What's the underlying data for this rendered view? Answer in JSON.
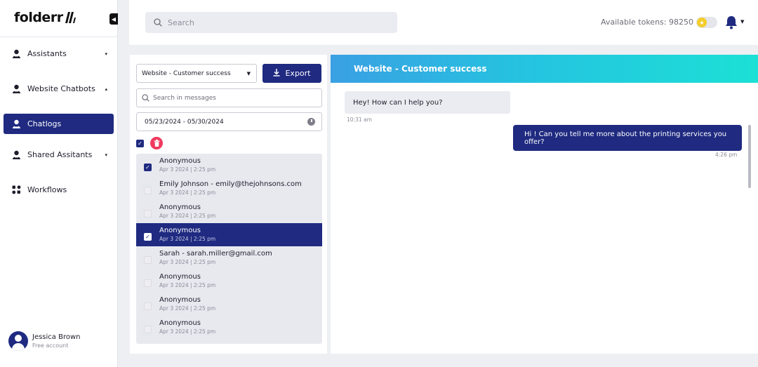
{
  "app": {
    "logo": "folderr"
  },
  "sidebar": {
    "items": [
      {
        "label": "Assistants",
        "icon": "assistant-icon",
        "caret": "▾",
        "active": false
      },
      {
        "label": "Website Chatbots",
        "icon": "assistant-icon",
        "caret": "▴",
        "active": false
      },
      {
        "label": "Chatlogs",
        "icon": "assistant-icon",
        "caret": "",
        "active": true
      },
      {
        "label": "Shared Assitants",
        "icon": "assistant-icon",
        "caret": "▾",
        "active": false
      },
      {
        "label": "Workflows",
        "icon": "workflow-icon",
        "caret": "",
        "active": false
      }
    ],
    "user": {
      "name": "Jessica Brown",
      "plan": "Free account"
    }
  },
  "header": {
    "search_placeholder": "Search",
    "tokens_label": "Available tokens: 98250",
    "help": "?"
  },
  "chatlogs": {
    "bot_select": "Website - Customer success",
    "export_label": "Export",
    "message_search_placeholder": "Search in messages",
    "date_range": "05/23/2024 - 05/30/2024",
    "conversations": [
      {
        "name": "Anonymous",
        "time": "Apr 3 2024 | 2:25 pm",
        "checked": true,
        "selected": false
      },
      {
        "name": "Emily Johnson  - emily@thejohnsons.com",
        "time": "Apr 3 2024 | 2:25 pm",
        "checked": false,
        "selected": false
      },
      {
        "name": "Anonymous",
        "time": "Apr 3 2024 | 2:25 pm",
        "checked": false,
        "selected": false
      },
      {
        "name": "Anonymous",
        "time": "Apr 3 2024 | 2:25 pm",
        "checked": true,
        "selected": true
      },
      {
        "name": "Sarah - sarah.miller@gmail.com",
        "time": "Apr 3 2024 | 2:25 pm",
        "checked": false,
        "selected": false
      },
      {
        "name": "Anonymous",
        "time": "Apr 3 2024 | 2:25 pm",
        "checked": false,
        "selected": false
      },
      {
        "name": "Anonymous",
        "time": "Apr 3 2024 | 2:25 pm",
        "checked": false,
        "selected": false
      },
      {
        "name": "Anonymous",
        "time": "Apr 3 2024 | 2:25 pm",
        "checked": false,
        "selected": false
      }
    ]
  },
  "conversation": {
    "title": "Website - Customer success",
    "messages": [
      {
        "from": "bot",
        "text": "Hey! How can I help you?",
        "time": "10:31 am"
      },
      {
        "from": "user",
        "text": "Hi ! Can you tell me more about the printing services you offer?",
        "time": "4:26 pm"
      }
    ]
  },
  "colors": {
    "primary": "#1f2a80",
    "danger": "#f03a5f",
    "gradient_start": "#3aa0e3",
    "gradient_end": "#1ce0d6",
    "token_coin": "#f3cd2b"
  }
}
